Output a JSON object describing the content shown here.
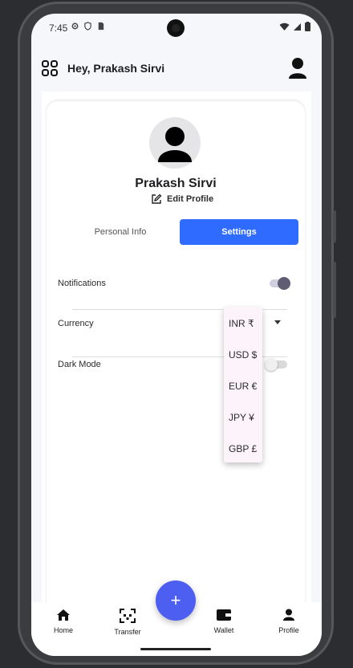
{
  "status": {
    "time": "7:45"
  },
  "header": {
    "greeting": "Hey, Prakash Sirvi",
    "menu_icon": "grid-icon",
    "profile_icon": "person-icon"
  },
  "profile": {
    "name": "Prakash Sirvi",
    "edit_label": "Edit Profile"
  },
  "tabs": [
    {
      "label": "Personal Info",
      "active": false
    },
    {
      "label": "Settings",
      "active": true
    }
  ],
  "settings": {
    "notifications": {
      "label": "Notifications",
      "enabled": true
    },
    "currency": {
      "label": "Currency",
      "selected": "INR ₹"
    },
    "dark_mode": {
      "label": "Dark Mode",
      "enabled": false
    }
  },
  "currency_options": [
    "INR ₹",
    "USD $",
    "EUR €",
    "JPY ¥",
    "GBP £"
  ],
  "bottom_nav": [
    {
      "label": "Home",
      "icon": "home-icon"
    },
    {
      "label": "Transfer",
      "icon": "qr-transfer-icon"
    },
    {
      "label": "Wallet",
      "icon": "wallet-icon"
    },
    {
      "label": "Profile",
      "icon": "person-icon"
    }
  ],
  "fab": {
    "symbol": "+"
  },
  "colors": {
    "accent": "#2f6bff",
    "fab": "#4d5ff0",
    "toggle_on_knob": "#5f5c73",
    "dropdown_bg": "#fcf4fa"
  }
}
